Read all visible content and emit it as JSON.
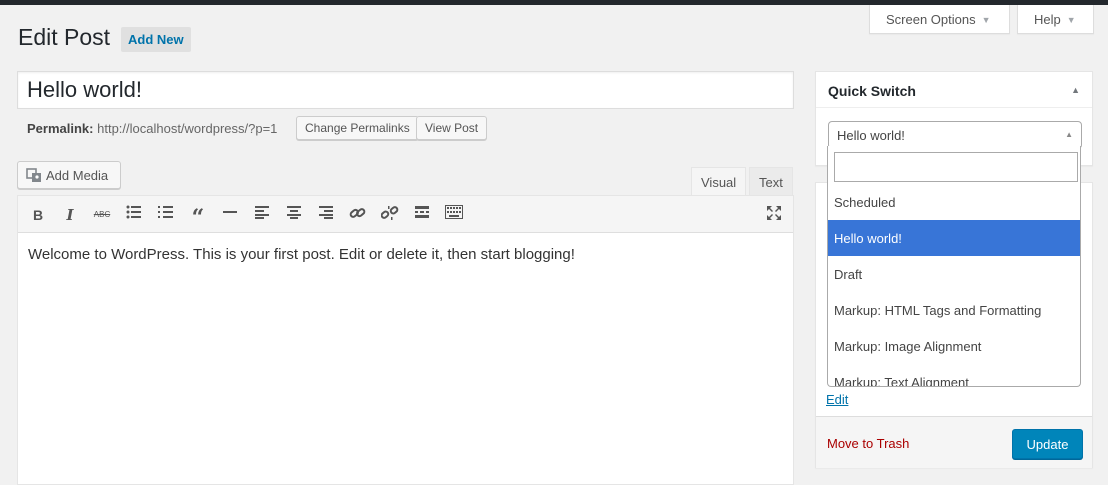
{
  "screen_meta": {
    "screen_options": "Screen Options",
    "help": "Help"
  },
  "page": {
    "title": "Edit Post",
    "add_new": "Add New"
  },
  "post": {
    "title": "Hello world!",
    "permalink_label": "Permalink:",
    "permalink_url": "http://localhost/wordpress/?p=1",
    "change_permalinks": "Change Permalinks",
    "view_post": "View Post"
  },
  "editor": {
    "add_media": "Add Media",
    "tab_visual": "Visual",
    "tab_text": "Text",
    "toolbar": [
      {
        "name": "bold-button",
        "glyph": "B"
      },
      {
        "name": "italic-button",
        "glyph": "I"
      },
      {
        "name": "strikethrough-button",
        "glyph": "ABC"
      },
      {
        "name": "bullet-list-button",
        "glyph": "☰"
      },
      {
        "name": "numbered-list-button",
        "glyph": "☷"
      },
      {
        "name": "blockquote-button",
        "glyph": "❝"
      },
      {
        "name": "horizontal-line-button",
        "glyph": "—"
      },
      {
        "name": "align-left-button",
        "glyph": "≡"
      },
      {
        "name": "align-center-button",
        "glyph": "≡"
      },
      {
        "name": "align-right-button",
        "glyph": "≡"
      },
      {
        "name": "insert-link-button",
        "glyph": "🔗"
      },
      {
        "name": "remove-link-button",
        "glyph": "⛓"
      },
      {
        "name": "read-more-button",
        "glyph": "▬"
      },
      {
        "name": "toolbar-toggle-button",
        "glyph": "▦"
      }
    ],
    "content": "Welcome to WordPress. This is your first post. Edit or delete it, then start blogging!"
  },
  "quick_switch": {
    "title": "Quick Switch",
    "selected": "Hello world!",
    "options": [
      "Scheduled",
      "Hello world!",
      "Draft",
      "Markup: HTML Tags and Formatting",
      "Markup: Image Alignment",
      "Markup: Text Alignment"
    ],
    "active_index": 1
  },
  "publish": {
    "edit_link": "Edit",
    "trash": "Move to Trash",
    "update": "Update"
  }
}
